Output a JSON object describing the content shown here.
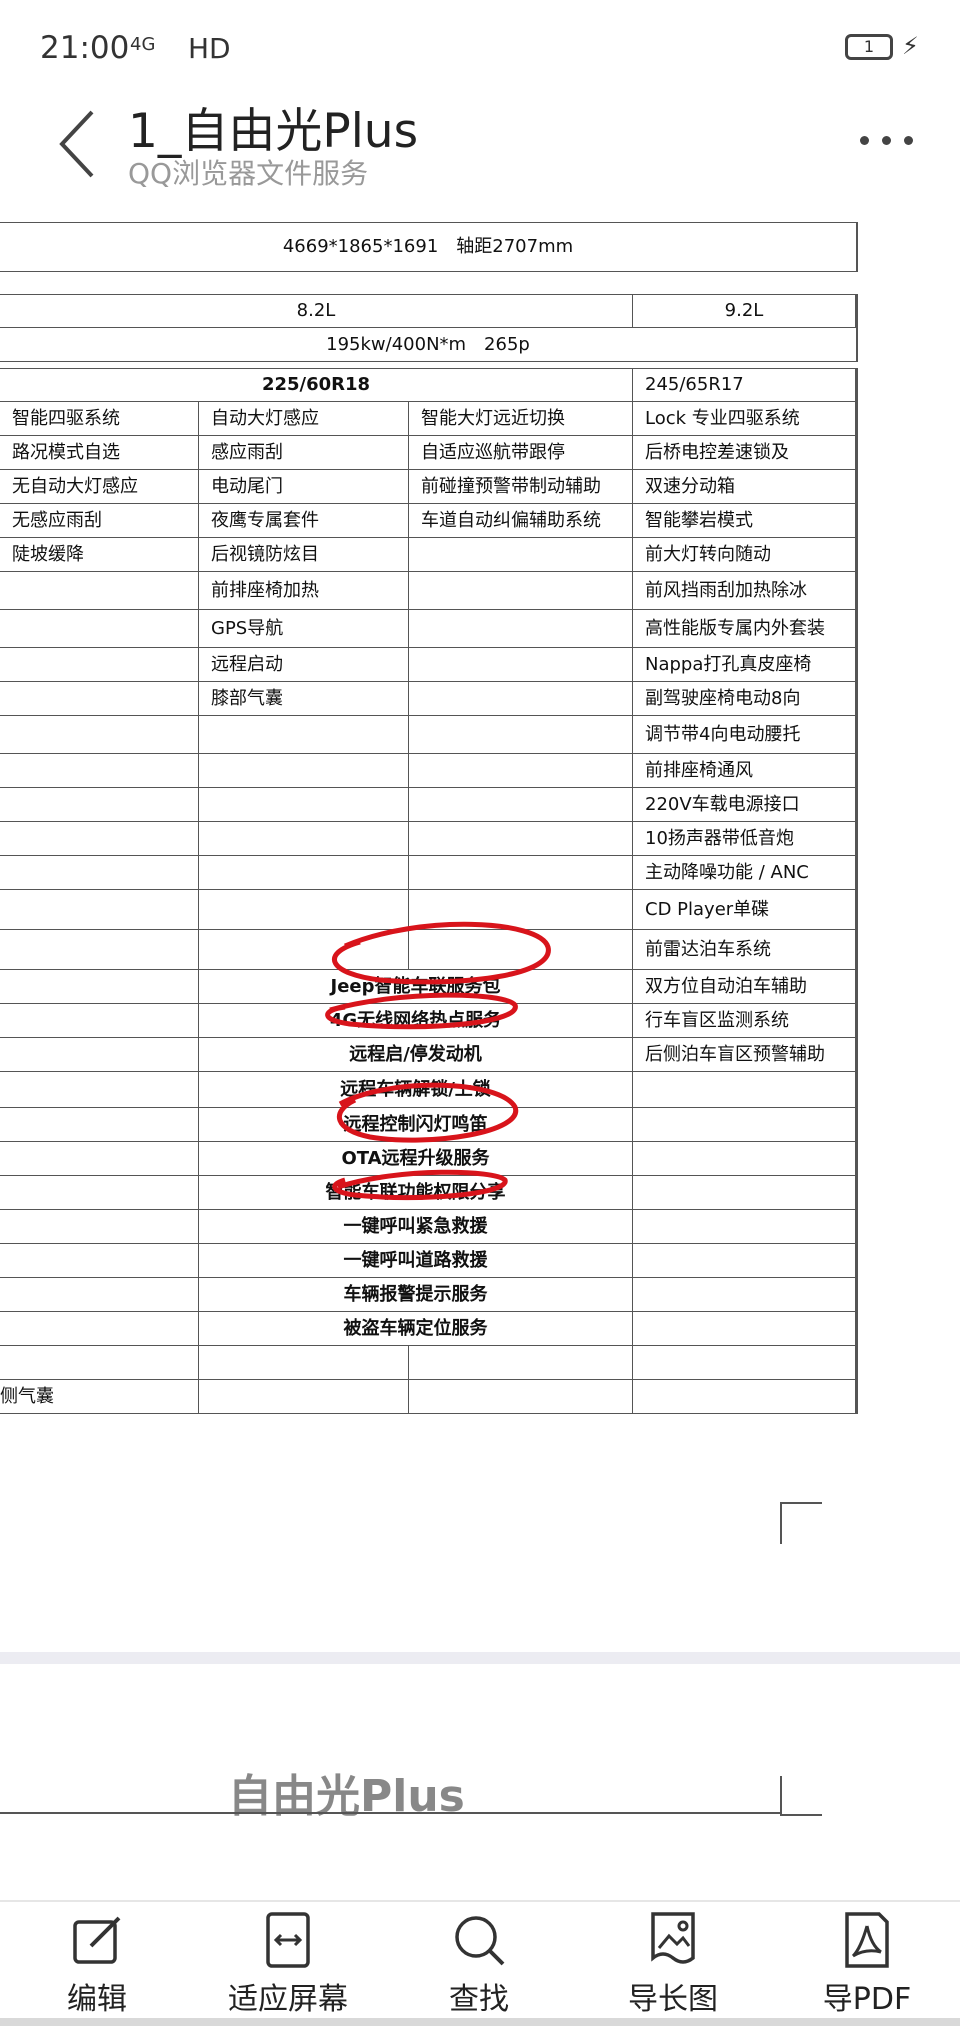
{
  "status_bar": {
    "time": "21:00",
    "network": "4G",
    "hd": "HD",
    "battery": "1"
  },
  "header": {
    "title": "1_自由光Plus",
    "subtitle": "QQ浏览器文件服务"
  },
  "sheet": {
    "dimensions": "4669*1865*1691　轴距2707mm",
    "fuel_a": "8.2L",
    "fuel_b": "9.2L",
    "engine": "195kw/400N*m　265p",
    "tyre_a": "225/60R18",
    "tyre_b": "245/65R17",
    "rows": [
      [
        "智能四驱系统",
        "自动大灯感应",
        "智能大灯远近切换",
        "Lock 专业四驱系统"
      ],
      [
        "路况模式自选",
        "感应雨刮",
        "自适应巡航带跟停",
        "后桥电控差速锁及"
      ],
      [
        "无自动大灯感应",
        "电动尾门",
        "前碰撞预警带制动辅助",
        "双速分动箱"
      ],
      [
        "无感应雨刮",
        "夜鹰专属套件",
        "车道自动纠偏辅助系统",
        "智能攀岩模式"
      ],
      [
        "陡坡缓降",
        "后视镜防炫目",
        "",
        "前大灯转向随动"
      ],
      [
        "",
        "前排座椅加热",
        "",
        "前风挡雨刮加热除冰"
      ],
      [
        "",
        "GPS导航",
        "",
        "高性能版专属内外套装"
      ],
      [
        "",
        "远程启动",
        "",
        "Nappa打孔真皮座椅"
      ],
      [
        "",
        "膝部气囊",
        "",
        "副驾驶座椅电动8向"
      ],
      [
        "",
        "",
        "",
        "调节带4向电动腰托"
      ],
      [
        "",
        "",
        "",
        "前排座椅通风"
      ],
      [
        "",
        "",
        "",
        "220V车载电源接口"
      ],
      [
        "",
        "",
        "",
        "10扬声器带低音炮"
      ],
      [
        "",
        "",
        "",
        "主动降噪功能 / ANC"
      ],
      [
        "",
        "",
        "",
        "CD Player单碟"
      ],
      [
        "",
        "",
        "",
        "前雷达泊车系统"
      ]
    ],
    "connect_rows": [
      [
        "Jeep智能车联服务包",
        "双方位自动泊车辅助"
      ],
      [
        "4G无线网络热点服务",
        "行车盲区监测系统"
      ],
      [
        "远程启/停发动机",
        "后侧泊车盲区预警辅助"
      ],
      [
        "远程车辆解锁/上锁",
        ""
      ],
      [
        "远程控制闪灯鸣笛",
        ""
      ],
      [
        "OTA远程升级服务",
        ""
      ],
      [
        "智能车联功能权限分享",
        ""
      ],
      [
        "一键呼叫紧急救援",
        ""
      ],
      [
        "一键呼叫道路救援",
        ""
      ],
      [
        "车辆报警提示服务",
        ""
      ],
      [
        "被盗车辆定位服务",
        ""
      ]
    ],
    "last_row_first_cell": "侧气囊"
  },
  "page2": {
    "title": "自由光Plus"
  },
  "toolbar": {
    "items": [
      {
        "label": "编辑",
        "icon": "edit-icon"
      },
      {
        "label": "适应屏幕",
        "icon": "fit-screen-icon"
      },
      {
        "label": "查找",
        "icon": "search-icon"
      },
      {
        "label": "导长图",
        "icon": "long-image-icon"
      },
      {
        "label": "导PDF",
        "icon": "pdf-icon"
      }
    ]
  },
  "colors": {
    "annotation": "#d8141b",
    "grid": "#555555",
    "page_gap": "#ececf2"
  }
}
